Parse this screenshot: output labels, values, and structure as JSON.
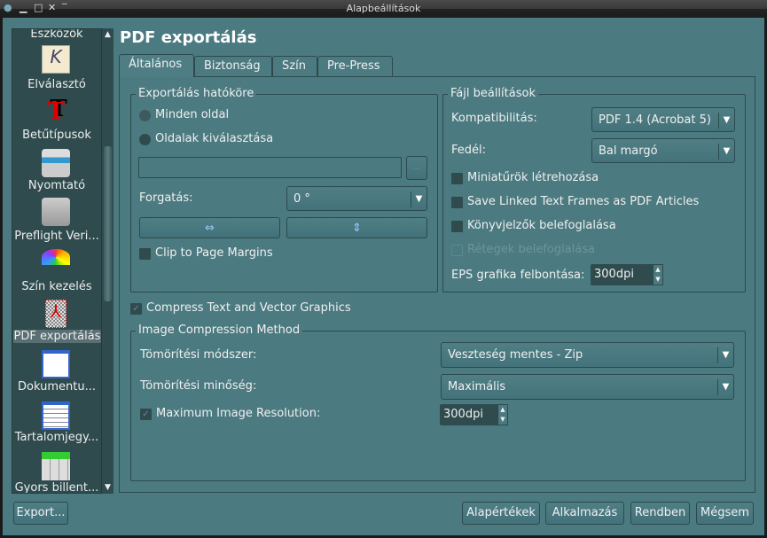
{
  "window": {
    "title": "Alapbeállítások"
  },
  "sidebar": {
    "items": [
      {
        "label": "Eszközök",
        "icon": "tools-icon"
      },
      {
        "label": "Elválasztó",
        "icon": "hyphenator-icon"
      },
      {
        "label": "Betűtípusok",
        "icon": "fonts-icon"
      },
      {
        "label": "Nyomtató",
        "icon": "printer-icon"
      },
      {
        "label": "Preflight Veri...",
        "icon": "preflight-icon"
      },
      {
        "label": "Szín kezelés",
        "icon": "color-management-icon"
      },
      {
        "label": "PDF exportálás",
        "icon": "pdf-icon",
        "selected": true
      },
      {
        "label": "Dokumentu...",
        "icon": "document-items-icon"
      },
      {
        "label": "Tartalomjegy...",
        "icon": "toc-icon"
      },
      {
        "label": "Gyors billent...",
        "icon": "keyboard-shortcuts-icon"
      }
    ]
  },
  "main": {
    "title": "PDF exportálás",
    "tabs": [
      {
        "label": "Általános",
        "active": true
      },
      {
        "label": "Biztonság"
      },
      {
        "label": "Szín"
      },
      {
        "label": "Pre-Press"
      }
    ],
    "scope": {
      "title": "Exportálás hatóköre",
      "all_pages": "Minden oldal",
      "choose_pages": "Oldalak kiválasztása",
      "selected": "all_pages",
      "pages_value": "",
      "browse": "...",
      "rotation_label": "Forgatás:",
      "rotation_value": "0 °",
      "clip_label": "Clip to Page Margins",
      "clip_checked": false
    },
    "file": {
      "title": "Fájl beállítások",
      "compat_label": "Kompatibilitás:",
      "compat_value": "PDF 1.4 (Acrobat 5)",
      "binding_label": "Fedél:",
      "binding_value": "Bal margó",
      "thumbnails": "Miniatűrök létrehozása",
      "articles": "Save Linked Text Frames as PDF Articles",
      "bookmarks": "Könyvjelzők belefoglalása",
      "layers": "Rétegek belefoglalása",
      "eps_label": "EPS grafika felbontása:",
      "eps_value": "300dpi"
    },
    "compress_text": {
      "label": "Compress Text and Vector Graphics",
      "checked": true
    },
    "image": {
      "title": "Image Compression Method",
      "method_label": "Tömörítési módszer:",
      "method_value": "Veszteség mentes - Zip",
      "quality_label": "Tömörítési minőség:",
      "quality_value": "Maximális",
      "maxres_label": "Maximum Image Resolution:",
      "maxres_checked": true,
      "maxres_value": "300dpi"
    }
  },
  "buttons": {
    "export": "Export...",
    "defaults": "Alapértékek",
    "apply": "Alkalmazás",
    "ok": "Rendben",
    "cancel": "Mégsem"
  },
  "colors": {
    "background": "#4b7a80",
    "sidebar": "#2f4b4e"
  }
}
